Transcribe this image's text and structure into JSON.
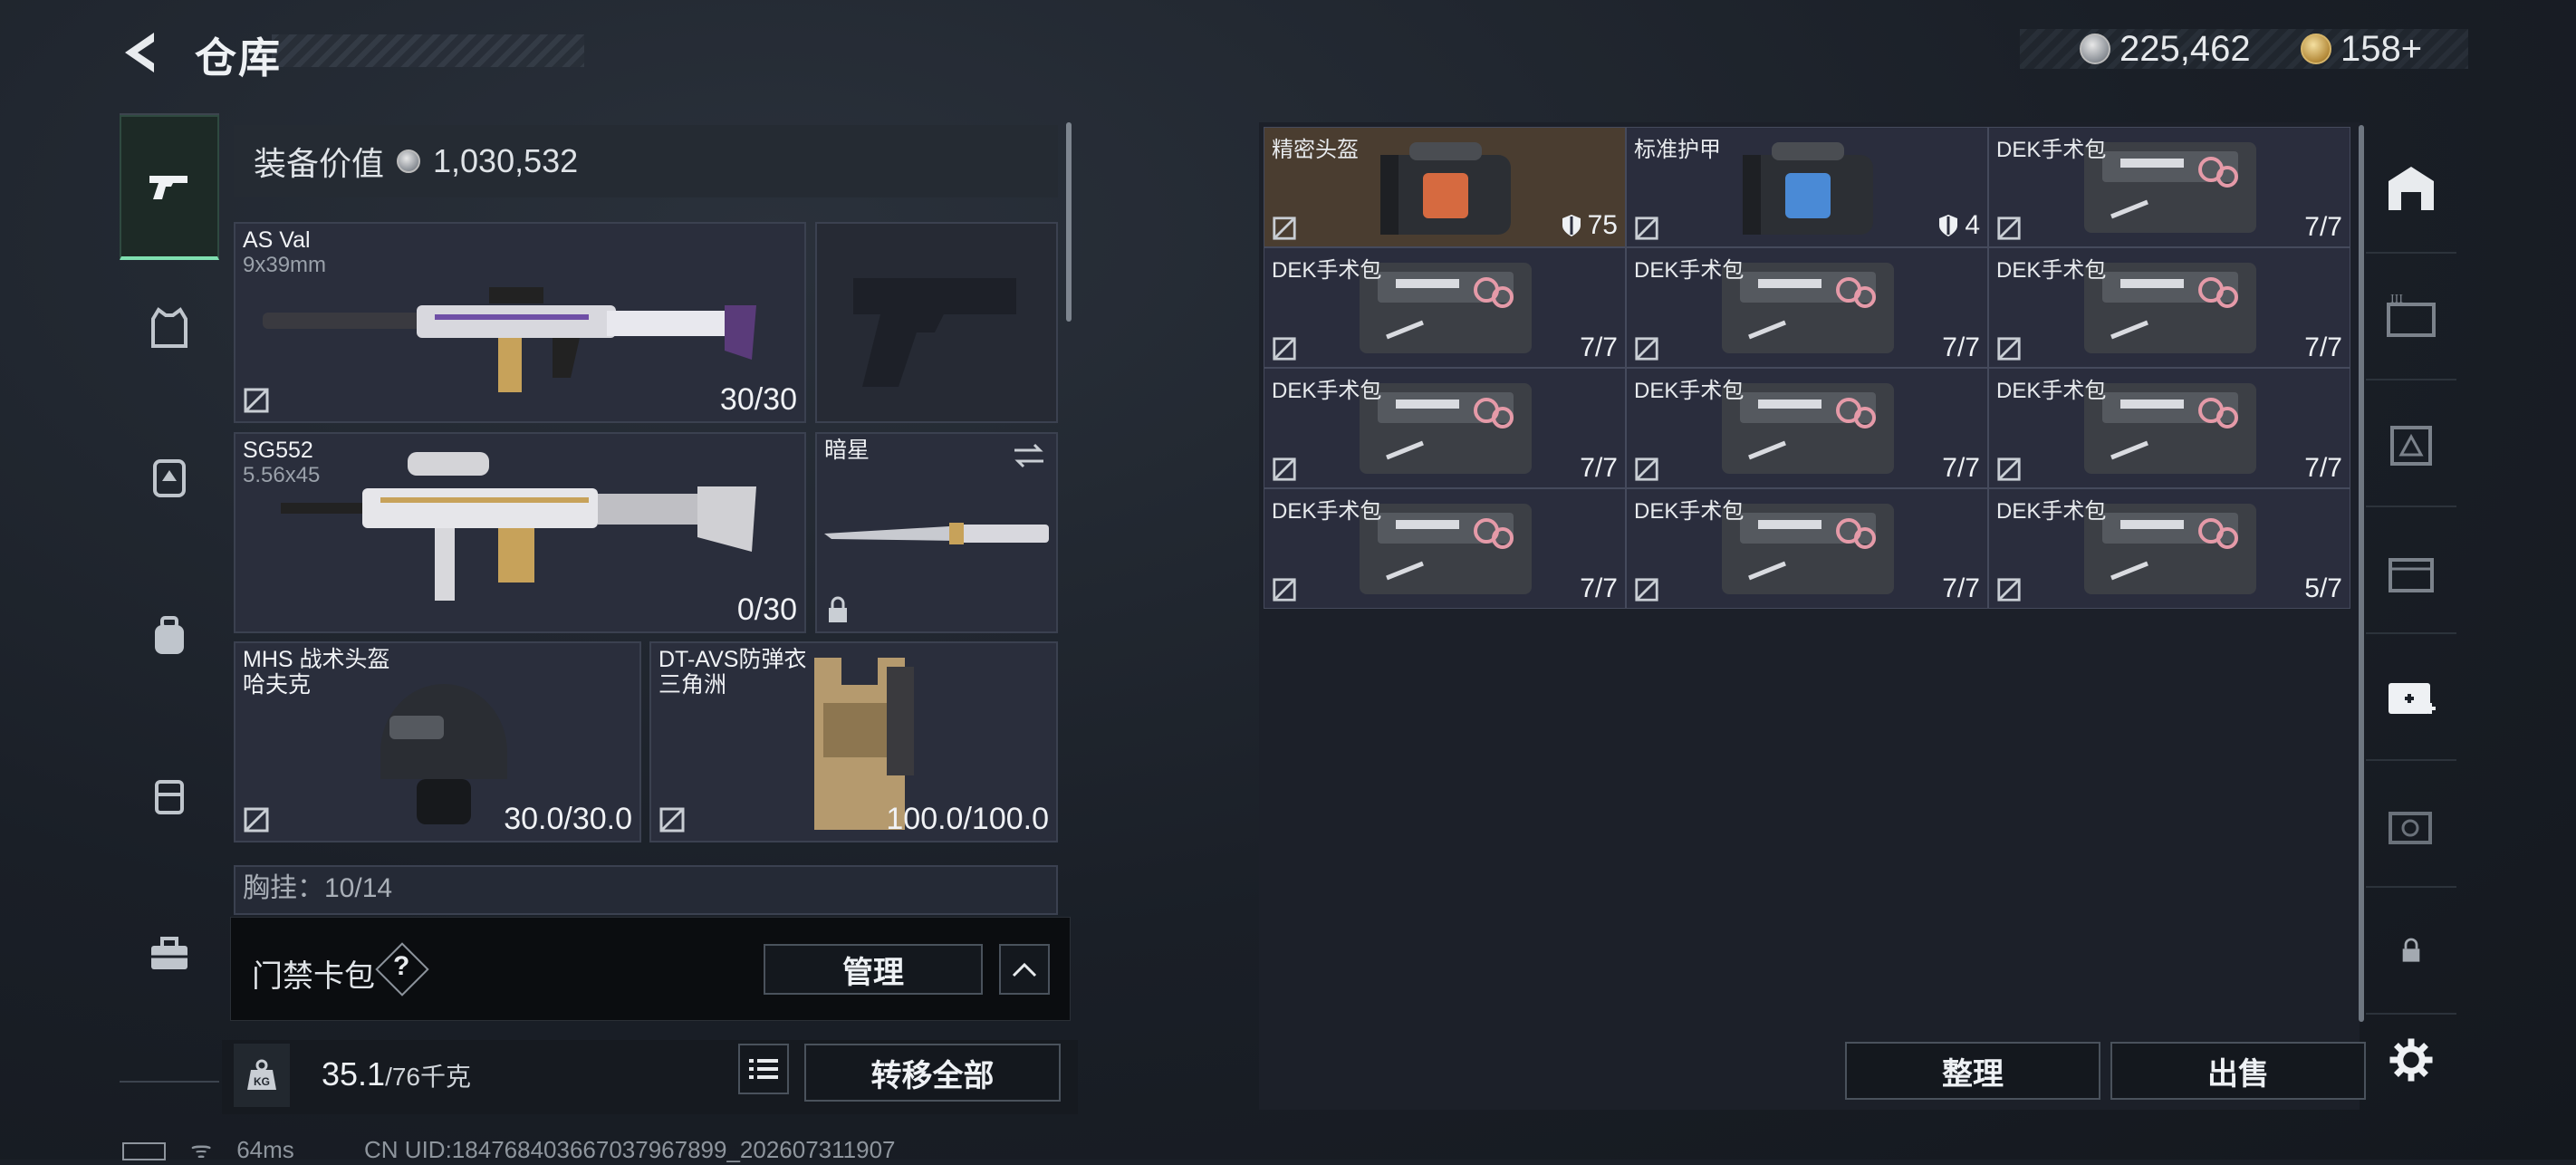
{
  "header": {
    "title": "仓库"
  },
  "currency": {
    "silver": "225,462",
    "gold": "158+"
  },
  "equipment": {
    "value_label": "装备价值",
    "value": "1,030,532",
    "primary": {
      "name": "AS Val",
      "ammo": "9x39mm",
      "count": "30/30"
    },
    "secondary": {
      "name": "SG552",
      "ammo": "5.56x45",
      "count": "0/30"
    },
    "melee": {
      "name": "暗星"
    },
    "helmet": {
      "name": "MHS 战术头盔",
      "sub": "哈夫克",
      "durability": "30.0/30.0"
    },
    "armor": {
      "name": "DT-AVS防弹衣",
      "sub": "三角洲",
      "durability": "100.0/100.0"
    },
    "next_row": "胸挂：10/14"
  },
  "access_card": {
    "label": "门禁卡包",
    "help": "?",
    "manage": "管理"
  },
  "weight": {
    "current": "35.1",
    "max": "/76千克"
  },
  "actions": {
    "transfer_all": "转移全部",
    "sort": "整理",
    "sell": "出售"
  },
  "status": {
    "ping": "64ms",
    "uid": "CN UID:18476840366703796789­9_202607311907"
  },
  "storage": {
    "items": [
      {
        "name": "精密头盔",
        "count": "75",
        "shield": true,
        "highlight": true
      },
      {
        "name": "标准护甲",
        "count": "4",
        "shield": true
      },
      {
        "name": "DEK手术包",
        "count": "7/7"
      },
      {
        "name": "DEK手术包",
        "count": "7/7"
      },
      {
        "name": "DEK手术包",
        "count": "7/7"
      },
      {
        "name": "DEK手术包",
        "count": "7/7"
      },
      {
        "name": "DEK手术包",
        "count": "7/7"
      },
      {
        "name": "DEK手术包",
        "count": "7/7"
      },
      {
        "name": "DEK手术包",
        "count": "7/7"
      },
      {
        "name": "DEK手术包",
        "count": "7/7"
      },
      {
        "name": "DEK手术包",
        "count": "7/7"
      },
      {
        "name": "DEK手术包",
        "count": "5/7"
      }
    ]
  }
}
